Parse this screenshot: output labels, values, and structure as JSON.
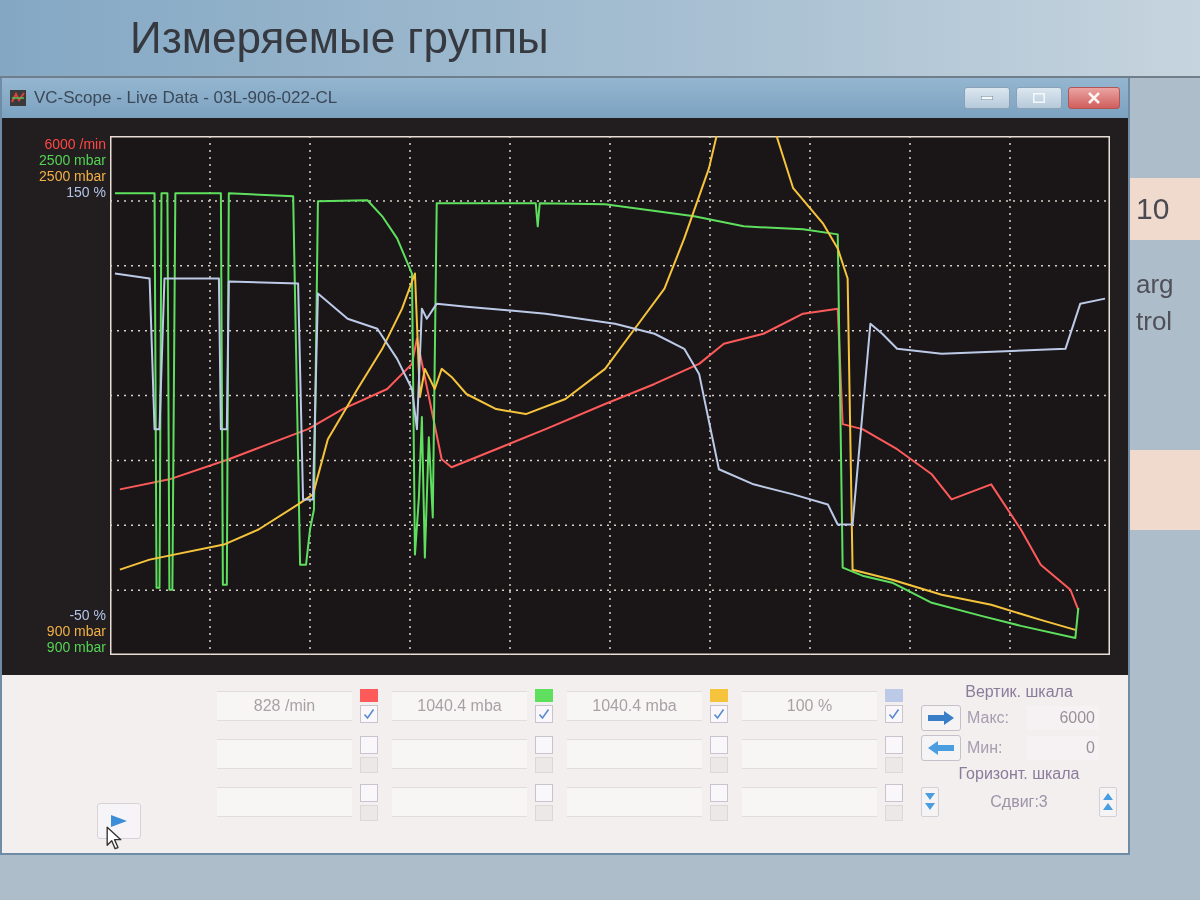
{
  "background": {
    "heading": "Измеряемые группы",
    "side_heading": "10",
    "side_lines": [
      "arg",
      "trol"
    ]
  },
  "window": {
    "title": "VC-Scope - Live Data - 03L-906-022-CL"
  },
  "scope": {
    "axis_top": [
      {
        "text": "6000 /min",
        "color": "#ff4646"
      },
      {
        "text": "2500 mbar",
        "color": "#54d454"
      },
      {
        "text": "2500 mbar",
        "color": "#f2b046"
      },
      {
        "text": "150 %",
        "color": "#b4c4e8"
      }
    ],
    "axis_bottom": [
      {
        "text": "-50 %",
        "color": "#b4c4e8"
      },
      {
        "text": "900 mbar",
        "color": "#f2b046"
      },
      {
        "text": "900 mbar",
        "color": "#54d454"
      }
    ]
  },
  "channels": [
    {
      "slots": [
        {
          "reading": "828 /min",
          "color": "#ff5a5a",
          "checked": true
        },
        {
          "checked": false
        },
        {
          "checked": false
        }
      ]
    },
    {
      "slots": [
        {
          "reading": "1040.4 mba",
          "color": "#5ee05e",
          "checked": true
        },
        {
          "checked": false
        },
        {
          "checked": false
        }
      ]
    },
    {
      "slots": [
        {
          "reading": "1040.4 mba",
          "color": "#f5c43c",
          "checked": true
        },
        {
          "checked": false
        },
        {
          "checked": false
        }
      ]
    },
    {
      "slots": [
        {
          "reading": "100 %",
          "color": "#bccae8",
          "checked": true
        },
        {
          "checked": false
        },
        {
          "checked": false
        }
      ]
    }
  ],
  "vertical_scale": {
    "title": "Вертик. шкала",
    "max_label": "Макс:",
    "max_value": "6000",
    "min_label": "Мин:",
    "min_value": "0"
  },
  "horizontal_scale": {
    "title": "Горизонт. шкала",
    "shift": "Сдвиг:3"
  }
}
